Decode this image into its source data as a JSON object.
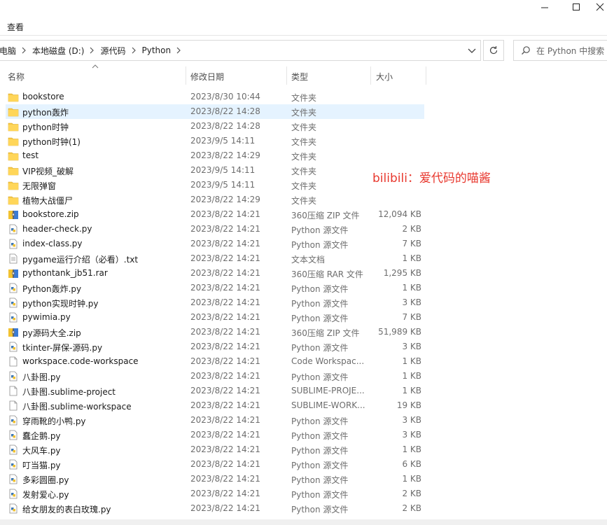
{
  "ribbon": {
    "view_tab": "查看"
  },
  "window": {
    "minimize": "–",
    "maximize": "☐",
    "close": "✕"
  },
  "address": {
    "crumbs": [
      "电脑",
      "本地磁盘 (D:)",
      "源代码",
      "Python"
    ],
    "refresh_icon": "refresh-icon"
  },
  "search": {
    "placeholder": "在 Python 中搜索"
  },
  "columns": {
    "name": "名称",
    "date": "修改日期",
    "type": "类型",
    "size": "大小"
  },
  "watermark": "bilibili：爱代码的喵酱",
  "files": [
    {
      "name": "bookstore",
      "date": "2023/8/30 10:44",
      "type": "文件夹",
      "size": "",
      "icon": "folder"
    },
    {
      "name": "python轰炸",
      "date": "2023/8/22 14:28",
      "type": "文件夹",
      "size": "",
      "icon": "folder",
      "selected": true
    },
    {
      "name": "python时钟",
      "date": "2023/8/22 14:28",
      "type": "文件夹",
      "size": "",
      "icon": "folder"
    },
    {
      "name": "python时钟(1)",
      "date": "2023/9/5 14:11",
      "type": "文件夹",
      "size": "",
      "icon": "folder"
    },
    {
      "name": "test",
      "date": "2023/8/22 14:29",
      "type": "文件夹",
      "size": "",
      "icon": "folder"
    },
    {
      "name": "VIP视频_破解",
      "date": "2023/9/5 14:11",
      "type": "文件夹",
      "size": "",
      "icon": "folder"
    },
    {
      "name": "无限弹窗",
      "date": "2023/9/5 14:11",
      "type": "文件夹",
      "size": "",
      "icon": "folder"
    },
    {
      "name": "植物大战僵尸",
      "date": "2023/8/22 14:29",
      "type": "文件夹",
      "size": "",
      "icon": "folder"
    },
    {
      "name": "bookstore.zip",
      "date": "2023/8/22 14:21",
      "type": "360压缩 ZIP 文件",
      "size": "12,094 KB",
      "icon": "archive"
    },
    {
      "name": "header-check.py",
      "date": "2023/8/22 14:21",
      "type": "Python 源文件",
      "size": "2 KB",
      "icon": "python"
    },
    {
      "name": "index-class.py",
      "date": "2023/8/22 14:21",
      "type": "Python 源文件",
      "size": "7 KB",
      "icon": "python"
    },
    {
      "name": "pygame运行介绍（必看）.txt",
      "date": "2023/8/22 14:21",
      "type": "文本文档",
      "size": "1 KB",
      "icon": "text"
    },
    {
      "name": "pythontank_jb51.rar",
      "date": "2023/8/22 14:21",
      "type": "360压缩 RAR 文件",
      "size": "1,295 KB",
      "icon": "archive"
    },
    {
      "name": "Python轰炸.py",
      "date": "2023/8/22 14:21",
      "type": "Python 源文件",
      "size": "1 KB",
      "icon": "python"
    },
    {
      "name": "python实现时钟.py",
      "date": "2023/8/22 14:21",
      "type": "Python 源文件",
      "size": "3 KB",
      "icon": "python"
    },
    {
      "name": "pywimia.py",
      "date": "2023/8/22 14:21",
      "type": "Python 源文件",
      "size": "7 KB",
      "icon": "python"
    },
    {
      "name": "py源码大全.zip",
      "date": "2023/8/22 14:21",
      "type": "360压缩 ZIP 文件",
      "size": "51,989 KB",
      "icon": "archive"
    },
    {
      "name": "tkinter-屏保-源码.py",
      "date": "2023/8/22 14:21",
      "type": "Python 源文件",
      "size": "3 KB",
      "icon": "python"
    },
    {
      "name": "workspace.code-workspace",
      "date": "2023/8/22 14:21",
      "type": "Code Workspac...",
      "size": "1 KB",
      "icon": "blank"
    },
    {
      "name": "八卦图.py",
      "date": "2023/8/22 14:21",
      "type": "Python 源文件",
      "size": "1 KB",
      "icon": "python"
    },
    {
      "name": "八卦图.sublime-project",
      "date": "2023/8/22 14:21",
      "type": "SUBLIME-PROJE...",
      "size": "1 KB",
      "icon": "blank"
    },
    {
      "name": "八卦图.sublime-workspace",
      "date": "2023/8/22 14:21",
      "type": "SUBLIME-WORK...",
      "size": "19 KB",
      "icon": "blank"
    },
    {
      "name": "穿雨靴的小鸭.py",
      "date": "2023/8/22 14:21",
      "type": "Python 源文件",
      "size": "3 KB",
      "icon": "python"
    },
    {
      "name": "蠢企鹅.py",
      "date": "2023/8/22 14:21",
      "type": "Python 源文件",
      "size": "3 KB",
      "icon": "python"
    },
    {
      "name": "大风车.py",
      "date": "2023/8/22 14:21",
      "type": "Python 源文件",
      "size": "1 KB",
      "icon": "python"
    },
    {
      "name": "叮当猫.py",
      "date": "2023/8/22 14:21",
      "type": "Python 源文件",
      "size": "6 KB",
      "icon": "python"
    },
    {
      "name": "多彩圆圈.py",
      "date": "2023/8/22 14:21",
      "type": "Python 源文件",
      "size": "1 KB",
      "icon": "python"
    },
    {
      "name": "发射爱心.py",
      "date": "2023/8/22 14:21",
      "type": "Python 源文件",
      "size": "2 KB",
      "icon": "python"
    },
    {
      "name": "给女朋友的表白玫瑰.py",
      "date": "2023/8/22 14:21",
      "type": "Python 源文件",
      "size": "2 KB",
      "icon": "python"
    }
  ]
}
